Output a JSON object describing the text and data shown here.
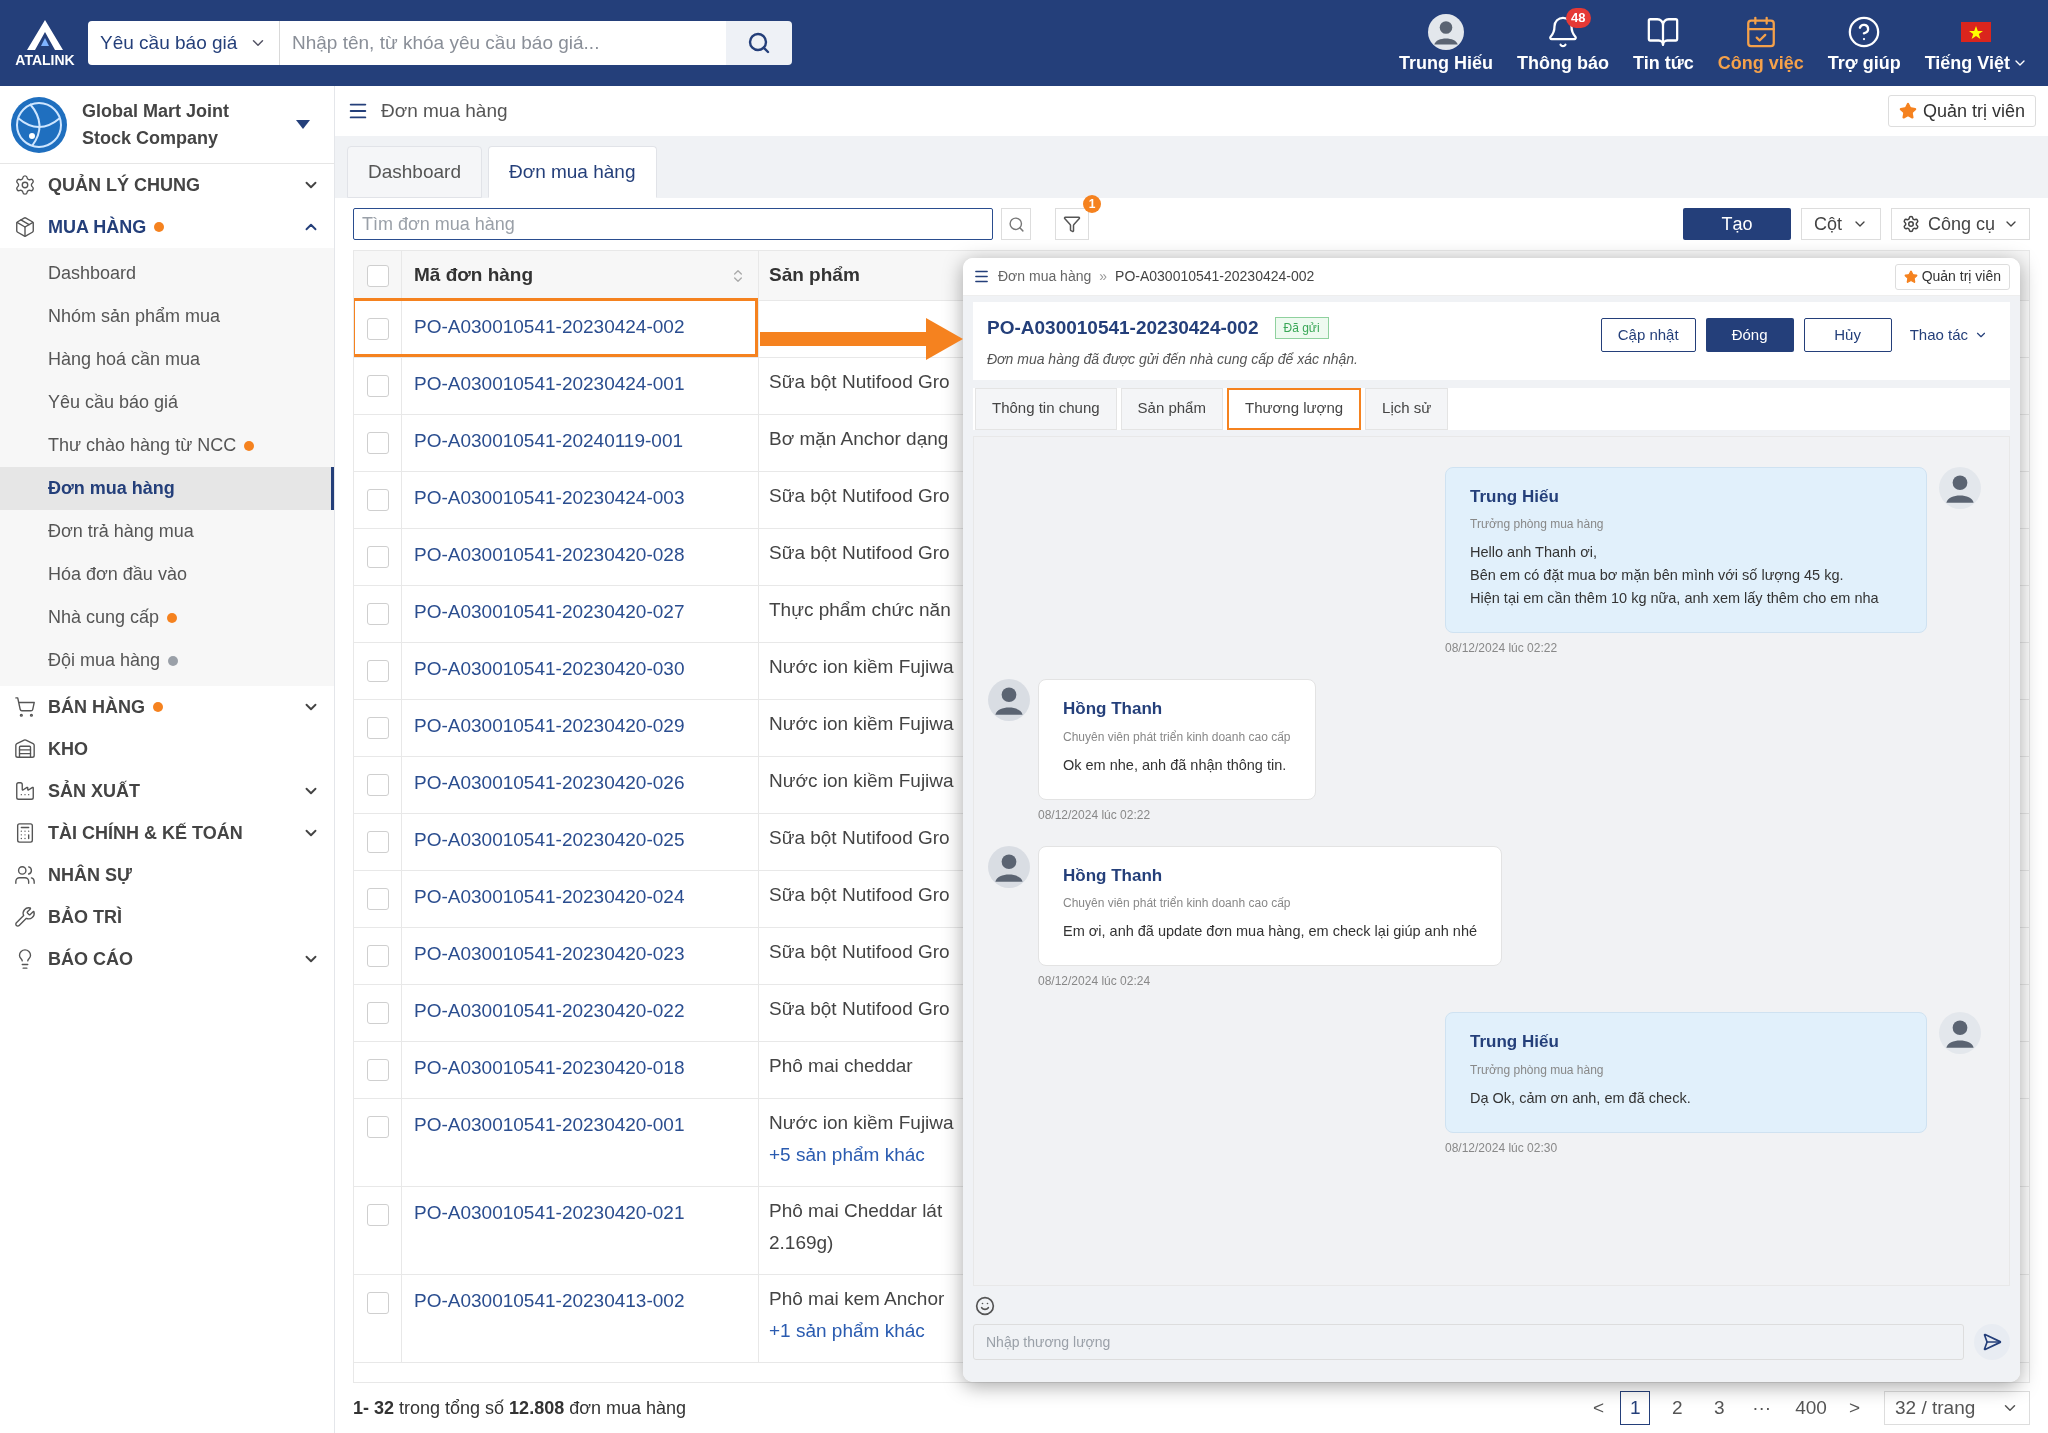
{
  "topbar": {
    "logo": "ATALINK",
    "search_scope": "Yêu cầu báo giá",
    "search_placeholder": "Nhập tên, từ khóa yêu cầu báo giá...",
    "nav": [
      {
        "label": "Trung Hiếu",
        "kind": "avatar",
        "selected": false
      },
      {
        "label": "Thông báo",
        "kind": "bell",
        "badge": "48",
        "selected": false
      },
      {
        "label": "Tin tức",
        "kind": "news",
        "selected": false
      },
      {
        "label": "Công việc",
        "kind": "tasks",
        "selected": true
      },
      {
        "label": "Trợ giúp",
        "kind": "help",
        "selected": false
      },
      {
        "label": "Tiếng Việt",
        "kind": "language",
        "selected": false
      }
    ]
  },
  "sidebar": {
    "company": "Global Mart Joint Stock Company",
    "menu": [
      {
        "label": "QUẢN LÝ CHUNG",
        "dot": false,
        "expandable": true,
        "expanded": false
      },
      {
        "label": "MUA HÀNG",
        "dot": true,
        "color": "#f5821f",
        "expandable": true,
        "expanded": true,
        "children": [
          {
            "label": "Dashboard",
            "dot": false,
            "selected": false
          },
          {
            "label": "Nhóm sản phẩm mua",
            "dot": false,
            "selected": false
          },
          {
            "label": "Hàng hoá cần mua",
            "dot": false,
            "selected": false
          },
          {
            "label": "Yêu cầu báo giá",
            "dot": false,
            "selected": false
          },
          {
            "label": "Thư chào hàng từ NCC",
            "dot": true,
            "color": "#f5821f",
            "selected": false
          },
          {
            "label": "Đơn mua hàng",
            "dot": false,
            "selected": true
          },
          {
            "label": "Đơn trả hàng mua",
            "dot": false,
            "selected": false
          },
          {
            "label": "Hóa đơn đầu vào",
            "dot": false,
            "selected": false
          },
          {
            "label": "Nhà cung cấp",
            "dot": true,
            "color": "#f5821f",
            "selected": false
          },
          {
            "label": "Đội mua hàng",
            "dot": true,
            "color": "#9aa0a8",
            "selected": false
          }
        ]
      },
      {
        "label": "BÁN HÀNG",
        "dot": true,
        "color": "#f5821f",
        "expandable": true,
        "expanded": false
      },
      {
        "label": "KHO",
        "dot": false,
        "expandable": false,
        "expanded": false
      },
      {
        "label": "SẢN XUẤT",
        "dot": false,
        "expandable": true,
        "expanded": false
      },
      {
        "label": "TÀI CHÍNH & KẾ TOÁN",
        "dot": false,
        "expandable": true,
        "expanded": false
      },
      {
        "label": "NHÂN SỰ",
        "dot": false,
        "expandable": false,
        "expanded": false
      },
      {
        "label": "BẢO TRÌ",
        "dot": false,
        "expandable": false,
        "expanded": false
      },
      {
        "label": "BÁO CÁO",
        "dot": false,
        "expandable": true,
        "expanded": false
      }
    ]
  },
  "page": {
    "breadcrumb": "Đơn mua hàng",
    "role_button": "Quản trị viên",
    "tabs": [
      {
        "label": "Dashboard",
        "selected": false
      },
      {
        "label": "Đơn mua hàng",
        "selected": true
      }
    ],
    "toolbar": {
      "search_placeholder": "Tìm đơn mua hàng",
      "filter_badge": "1",
      "buttons": [
        {
          "label": "Tạo",
          "kind": "primary"
        },
        {
          "label": "Cột",
          "kind": "dropdown"
        },
        {
          "label": "Công cụ",
          "kind": "tools"
        }
      ]
    },
    "table": {
      "all_checked": false,
      "columns": [
        "Mã đơn hàng",
        "Sản phẩm"
      ],
      "rows": [
        {
          "code": "PO-A030010541-20230424-002",
          "selected": true,
          "checked": false
        },
        {
          "code": "PO-A030010541-20230424-001",
          "product": [
            {
              "text": "Sữa bột Nutifood Gro",
              "kind": "text"
            }
          ],
          "selected": false,
          "checked": false
        },
        {
          "code": "PO-A030010541-20240119-001",
          "product": [
            {
              "text": "Bơ mặn Anchor dạng",
              "kind": "text"
            }
          ],
          "selected": false,
          "checked": false
        },
        {
          "code": "PO-A030010541-20230424-003",
          "product": [
            {
              "text": "Sữa bột Nutifood Gro",
              "kind": "text"
            }
          ],
          "selected": false,
          "checked": false
        },
        {
          "code": "PO-A030010541-20230420-028",
          "product": [
            {
              "text": "Sữa bột Nutifood Gro",
              "kind": "text"
            }
          ],
          "selected": false,
          "checked": false
        },
        {
          "code": "PO-A030010541-20230420-027",
          "product": [
            {
              "text": "Thực phẩm chức năn",
              "kind": "text"
            }
          ],
          "selected": false,
          "checked": false
        },
        {
          "code": "PO-A030010541-20230420-030",
          "product": [
            {
              "text": "Nước ion kiềm Fujiwa",
              "kind": "text"
            }
          ],
          "selected": false,
          "checked": false
        },
        {
          "code": "PO-A030010541-20230420-029",
          "product": [
            {
              "text": "Nước ion kiềm Fujiwa",
              "kind": "text"
            }
          ],
          "selected": false,
          "checked": false
        },
        {
          "code": "PO-A030010541-20230420-026",
          "product": [
            {
              "text": "Nước ion kiềm Fujiwa",
              "kind": "text"
            }
          ],
          "selected": false,
          "checked": false
        },
        {
          "code": "PO-A030010541-20230420-025",
          "product": [
            {
              "text": "Sữa bột Nutifood Gro",
              "kind": "text"
            }
          ],
          "selected": false,
          "checked": false
        },
        {
          "code": "PO-A030010541-20230420-024",
          "product": [
            {
              "text": "Sữa bột Nutifood Gro",
              "kind": "text"
            }
          ],
          "selected": false,
          "checked": false
        },
        {
          "code": "PO-A030010541-20230420-023",
          "product": [
            {
              "text": "Sữa bột Nutifood Gro",
              "kind": "text"
            }
          ],
          "selected": false,
          "checked": false
        },
        {
          "code": "PO-A030010541-20230420-022",
          "product": [
            {
              "text": "Sữa bột Nutifood Gro",
              "kind": "text"
            }
          ],
          "selected": false,
          "checked": false
        },
        {
          "code": "PO-A030010541-20230420-018",
          "product": [
            {
              "text": "Phô mai cheddar",
              "kind": "text"
            }
          ],
          "selected": false,
          "checked": false
        },
        {
          "code": "PO-A030010541-20230420-001",
          "product": [
            {
              "text": "Nước ion kiềm Fujiwa",
              "kind": "text"
            },
            {
              "text": "+5 sản phẩm khác",
              "kind": "more"
            }
          ],
          "selected": false,
          "checked": false
        },
        {
          "code": "PO-A030010541-20230420-021",
          "product": [
            {
              "text": "Phô mai Cheddar lát",
              "kind": "text"
            },
            {
              "text": "2.169g)",
              "kind": "text"
            }
          ],
          "selected": false,
          "checked": false
        },
        {
          "code": "PO-A030010541-20230413-002",
          "product": [
            {
              "text": "Phô mai kem Anchor",
              "kind": "text"
            },
            {
              "text": "+1 sản phẩm khác",
              "kind": "more"
            }
          ],
          "selected": false,
          "checked": false
        }
      ]
    },
    "footer": {
      "summary": "**1- 32** trong tổng số **12.808** đơn mua hàng",
      "prev": "<",
      "next": ">",
      "pages": [
        {
          "label": "1",
          "selected": true
        },
        {
          "label": "2",
          "selected": false
        },
        {
          "label": "3",
          "selected": false
        },
        {
          "label": "···",
          "selected": false
        },
        {
          "label": "400",
          "selected": false
        }
      ],
      "page_size": "32 / trang"
    }
  },
  "detail": {
    "highlight_arrow": true,
    "breadcrumb": [
      "Đơn mua hàng",
      "PO-A030010541-20230424-002"
    ],
    "separator": "»",
    "role_button": "Quản trị viên",
    "title": "PO-A030010541-20230424-002",
    "status": "Đã gửi",
    "description": "Đơn mua hàng đã được gửi đến nhà cung cấp để xác nhận.",
    "actions": [
      {
        "label": "Cập nhật",
        "kind": "outline"
      },
      {
        "label": "Đóng",
        "kind": "primary"
      },
      {
        "label": "Hủy",
        "kind": "outline"
      },
      {
        "label": "Thao tác",
        "kind": "menu"
      }
    ],
    "tabs": [
      {
        "label": "Thông tin chung",
        "selected": false
      },
      {
        "label": "Sản phẩm",
        "selected": false
      },
      {
        "label": "Thương lượng",
        "selected": true
      },
      {
        "label": "Lịch sử",
        "selected": false
      }
    ],
    "messages": [
      {
        "kind": "outgoing",
        "name": "Trung Hiếu",
        "role": "Trưởng phòng mua hàng",
        "text": "Hello anh Thanh ơi,\nBên em có đặt mua bơ mặn bên mình với số lượng 45 kg.\nHiện tại em cần thêm 10 kg nữa, anh xem lấy thêm cho em nha",
        "time": "08/12/2024 lúc 02:22"
      },
      {
        "kind": "incoming",
        "name": "Hồng Thanh",
        "role": "Chuyên viên phát triển kinh doanh cao cấp",
        "text": "Ok em nhe, anh đã nhận thông tin.",
        "time": "08/12/2024 lúc 02:22"
      },
      {
        "kind": "incoming",
        "name": "Hồng Thanh",
        "role": "Chuyên viên phát triển kinh doanh cao cấp",
        "text": "Em ơi, anh đã update đơn mua hàng, em check lại giúp anh nhé",
        "time": "08/12/2024 lúc 02:24"
      },
      {
        "kind": "outgoing",
        "name": "Trung Hiếu",
        "role": "Trưởng phòng mua hàng",
        "text": "Dạ Ok, cảm ơn anh, em đã check.",
        "time": "08/12/2024 lúc 02:30"
      }
    ],
    "input_placeholder": "Nhập thương lượng"
  }
}
